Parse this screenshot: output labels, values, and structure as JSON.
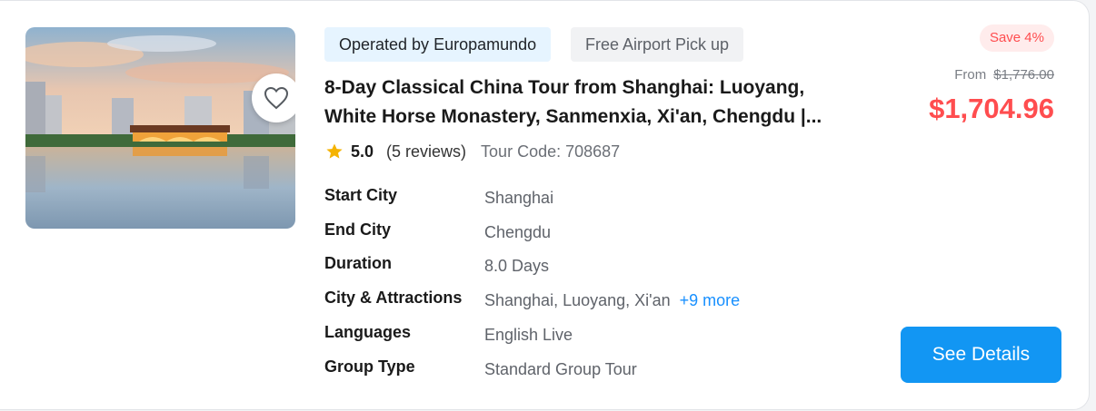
{
  "tags": {
    "operator": "Operated by Europamundo",
    "pickup": "Free Airport Pick up"
  },
  "tour": {
    "title_line1": "8-Day Classical China Tour from Shanghai: Luoyang,",
    "title_line2": "White Horse Monastery, Sanmenxia, Xi'an, Chengdu |...",
    "rating": "5.0",
    "reviews": "(5 reviews)",
    "code_label": "Tour Code:",
    "code": "708687"
  },
  "details": [
    {
      "key": "Start City",
      "value": "Shanghai"
    },
    {
      "key": "End City",
      "value": "Chengdu"
    },
    {
      "key": "Duration",
      "value": "8.0 Days"
    },
    {
      "key": "City & Attractions",
      "value": "Shanghai, Luoyang, Xi'an",
      "more": "+9 more"
    },
    {
      "key": "Languages",
      "value": "English Live"
    },
    {
      "key": "Group Type",
      "value": "Standard Group Tour"
    }
  ],
  "pricing": {
    "save": "Save 4%",
    "from_label": "From",
    "original": "$1,776.00",
    "price": "$1,704.96"
  },
  "cta": {
    "label": "See Details"
  },
  "icons": {
    "favorite": "heart-outline-icon",
    "rating": "star-icon"
  },
  "colors": {
    "accent": "#1296f3",
    "price": "#ff4d4f",
    "star": "#f5b301",
    "link": "#1890ff"
  }
}
